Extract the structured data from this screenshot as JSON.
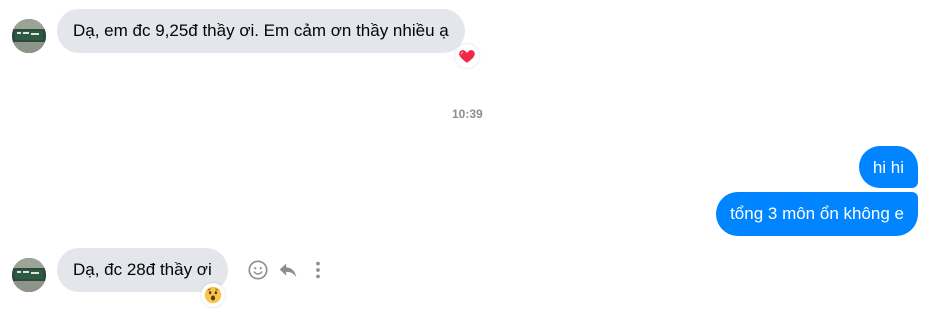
{
  "messages": [
    {
      "side": "incoming",
      "text": "Dạ, em đc 9,25đ thầy ơi. Em cảm ơn thầy nhiều ạ",
      "reaction": "heart-icon"
    },
    {
      "side": "incoming",
      "text": "Dạ, đc 28đ thầy ơi",
      "reaction": "wow-face-icon"
    }
  ],
  "outgoing": [
    {
      "text": "hi hi"
    },
    {
      "text": "tổng 3 môn ổn không e"
    }
  ],
  "timestamp": "10:39",
  "hover_actions": [
    "smiley-react-icon",
    "reply-icon",
    "more-options-icon"
  ],
  "colors": {
    "incoming_bubble": "#e4e6eb",
    "outgoing_bubble": "#0084ff",
    "timestamp": "#8a8d91"
  }
}
